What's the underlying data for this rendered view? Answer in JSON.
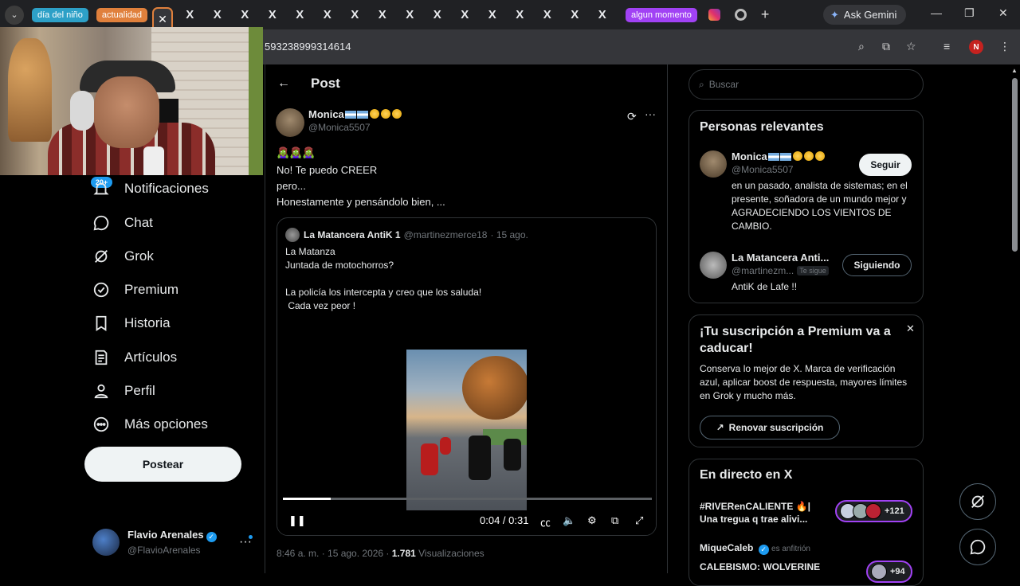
{
  "browser": {
    "tab_groups": [
      "día del niño",
      "actualidad",
      "algun momento"
    ],
    "x_tab_glyph": "X",
    "x_tab_count": 16,
    "active_tab_close": "✕",
    "new_tab": "+",
    "gemini_label": "Ask Gemini",
    "url": "593238999314614",
    "profile_initial": "N",
    "icons": [
      "search-icon",
      "install-icon",
      "bookmark-star-icon",
      "media-queue-icon",
      "more-vert-icon"
    ]
  },
  "nav": {
    "notif_badge": "20+",
    "items": [
      {
        "label": "Notificaciones",
        "icon": "bell-icon"
      },
      {
        "label": "Chat",
        "icon": "chat-icon"
      },
      {
        "label": "Grok",
        "icon": "grok-icon"
      },
      {
        "label": "Premium",
        "icon": "premium-icon"
      },
      {
        "label": "Historia",
        "icon": "bookmark-icon"
      },
      {
        "label": "Artículos",
        "icon": "article-icon"
      },
      {
        "label": "Perfil",
        "icon": "person-icon"
      },
      {
        "label": "Más opciones",
        "icon": "more-circle-icon"
      }
    ],
    "post_button": "Postear",
    "account": {
      "name": "Flavio Arenales",
      "handle": "@FlavioArenales"
    }
  },
  "post": {
    "header": "Post",
    "author": {
      "name": "Monica",
      "handle": "@Monica5507"
    },
    "emojis": "🧟‍♀️🧟‍♀️🧟‍♀️",
    "text_lines": [
      "No! Te puedo CREER",
      "pero...",
      "Honestamente y pensándolo bien, ..."
    ],
    "quote": {
      "name": "La Matancera AntiK 1",
      "handle": "@martinezmerce18",
      "date": "· 15 ago.",
      "text": "La Matanza\nJuntada de motochorros?\n\nLa policía los intercepta y creo que los saluda!\n Cada vez peor !",
      "video": {
        "current": "0:04",
        "total": "0:31",
        "time_display": "0:04 / 0:31",
        "progress": 0.129
      }
    },
    "meta": {
      "time": "8:46 a. m. · 15 ago. 2026 · ",
      "views": "1.781",
      "views_label": " Visualizaciones"
    }
  },
  "right": {
    "search_placeholder": "Buscar",
    "relevant": {
      "title": "Personas relevantes",
      "people": [
        {
          "name": "Monica",
          "handle": "@Monica5507",
          "bio": "en un pasado, analista de sistemas; en el presente, soñadora de un mundo mejor y AGRADECIENDO LOS VIENTOS DE CAMBIO.",
          "button": "Seguir"
        },
        {
          "name": "La Matancera Anti...",
          "handle": "@martinezm...",
          "tag": "Te sigue",
          "bio": "AntiK de Lafe !!",
          "button": "Siguiendo"
        }
      ]
    },
    "premium": {
      "title": "¡Tu suscripción a Premium va a caducar!",
      "text": "Conserva lo mejor de X. Marca de verificación azul, aplicar boost de respuesta, mayores límites en Grok y mucho más.",
      "button": "Renovar suscripción"
    },
    "live": {
      "title": "En directo en X",
      "items": [
        {
          "title_line1": "#RIVERenCALIENTE 🔥|",
          "title_line2": "Una tregua q trae alivi...",
          "count": "+121"
        },
        {
          "host": "MiqueCaleb",
          "host_role": "es anfitrión",
          "title_line1": "CALEBISMO: WOLVERINE",
          "count": "+94"
        }
      ]
    }
  },
  "colors": {
    "accent": "#1d9bf0",
    "group_orange": "#e0803c",
    "group_purple": "#a142f4",
    "group_blue": "#2da0c7"
  }
}
